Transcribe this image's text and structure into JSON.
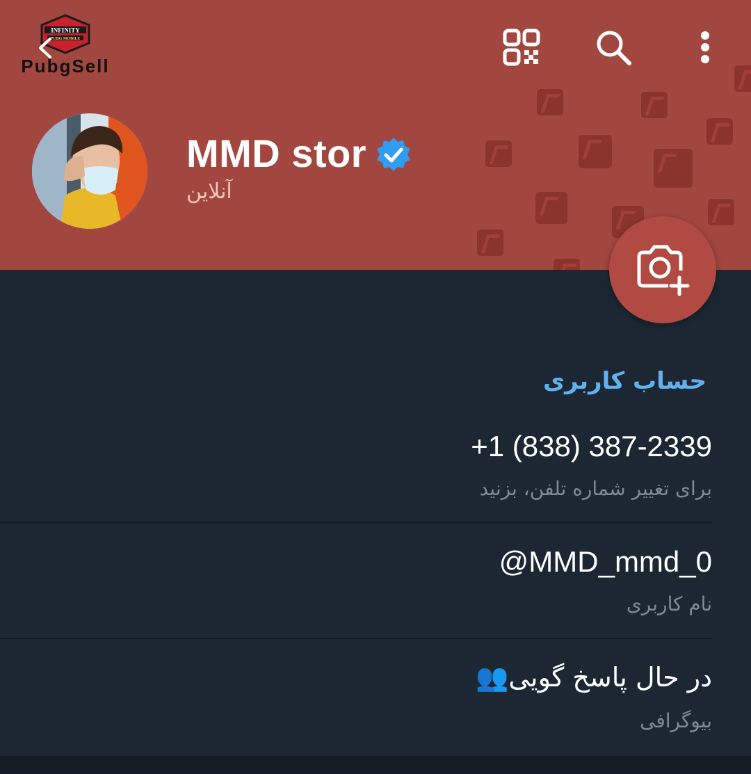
{
  "watermark": {
    "logo_text_top": "INFINITY",
    "logo_text_mid": "PUBG MOBILE",
    "logo_text_brand": "PubgSell"
  },
  "toolbar": {
    "icons": [
      "back-arrow-icon",
      "qr-code-icon",
      "search-icon",
      "more-vert-icon"
    ]
  },
  "profile": {
    "name": "MMD stor",
    "status": "آنلاین",
    "verified": true
  },
  "account_section": {
    "title": "حساب کاربری",
    "items": [
      {
        "value": "+1 (838) 387-2339",
        "caption": "برای تغییر شماره تلفن، بزنید"
      },
      {
        "value": "@MMD_mmd_0",
        "caption": "نام کاربری"
      },
      {
        "value": "در حال پاسخ گویی👥",
        "caption": "بیوگرافی"
      }
    ]
  },
  "colors": {
    "header_bg": "#a2473f",
    "body_bg": "#1d2733",
    "accent_blue": "#5fb1ef",
    "fab_bg": "#b04a42",
    "caption": "#7d8a97"
  }
}
